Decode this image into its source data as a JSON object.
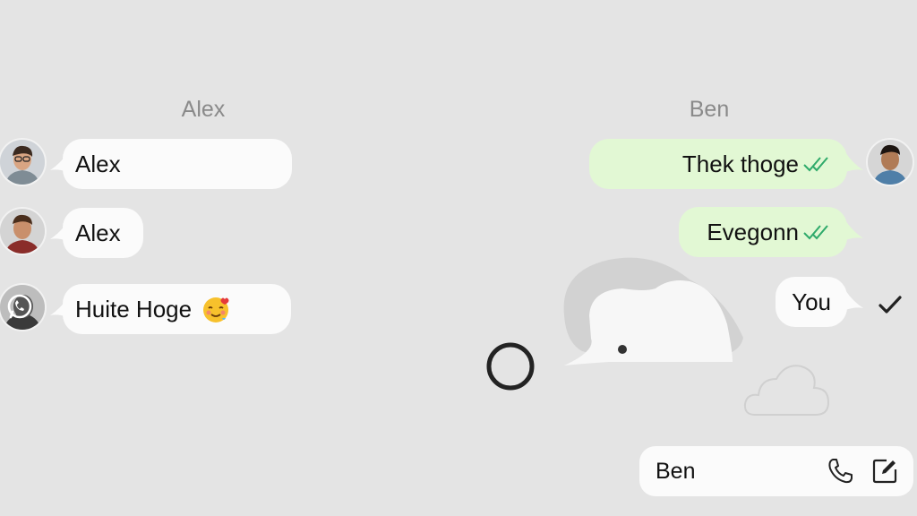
{
  "left_panel": {
    "header": "Alex",
    "messages": [
      {
        "text": "Alex"
      },
      {
        "text": "Alex"
      },
      {
        "text": "Huite Hoge",
        "emoji": "smiling-face-with-hearts-emoji"
      }
    ]
  },
  "right_panel": {
    "header": "Ben",
    "messages": [
      {
        "text": "Thek thoge",
        "status": "read-double-check"
      },
      {
        "text": "Evegonn",
        "status": "read-double-check"
      },
      {
        "text": "You",
        "status": "sent-single-check"
      }
    ]
  },
  "composer": {
    "value": "Ben",
    "icons": [
      "phone-icon",
      "compose-icon"
    ]
  },
  "colors": {
    "background": "#e4e4e4",
    "incoming_bubble": "#fbfbfb",
    "outgoing_bubble": "#e2f8d4",
    "read_tick": "#2eaa6a"
  }
}
